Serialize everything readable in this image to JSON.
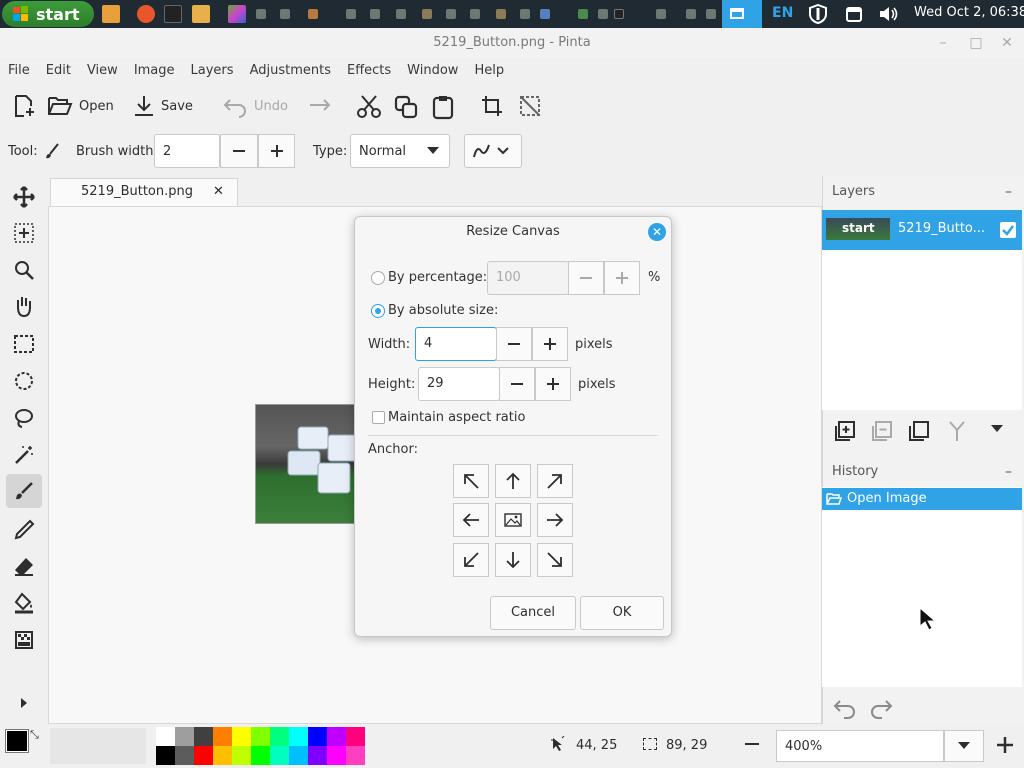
{
  "taskbar": {
    "start_label": "start",
    "language": "EN",
    "clock": "Wed Oct 2, 06:38"
  },
  "window": {
    "title": "5219_Button.png - Pinta"
  },
  "menu": [
    "File",
    "Edit",
    "View",
    "Image",
    "Layers",
    "Adjustments",
    "Effects",
    "Window",
    "Help"
  ],
  "toolbar": {
    "open_label": "Open",
    "save_label": "Save",
    "undo_label": "Undo"
  },
  "tool_options": {
    "tool_label": "Tool:",
    "brush_width_label": "Brush width:",
    "brush_width_value": "2",
    "type_label": "Type:",
    "type_value": "Normal"
  },
  "document": {
    "tab_name": "5219_Button.png"
  },
  "layers_panel": {
    "title": "Layers",
    "layer_name": "5219_Butto...",
    "thumb_label": "start"
  },
  "history_panel": {
    "title": "History",
    "items": [
      "Open Image"
    ]
  },
  "status": {
    "cursor_pos": "44, 25",
    "selection_size": "89, 29",
    "zoom": "400%"
  },
  "dialog": {
    "title": "Resize Canvas",
    "by_percentage_label": "By percentage:",
    "percentage_value": "100",
    "percent_unit": "%",
    "by_absolute_label": "By absolute size:",
    "width_label": "Width:",
    "width_value": "4",
    "height_label": "Height:",
    "height_value": "29",
    "pixels_unit": "pixels",
    "maintain_aspect_label": "Maintain aspect ratio",
    "anchor_label": "Anchor:",
    "cancel_label": "Cancel",
    "ok_label": "OK"
  },
  "palette_colors": [
    "#ffffff",
    "#000000",
    "#9e9e9e",
    "#5c5c5c",
    "#404040",
    "#ff0000",
    "#ff7f00",
    "#ffbf00",
    "#ffff00",
    "#bfff00",
    "#7fff00",
    "#00ff00",
    "#00ff7f",
    "#00ffbf",
    "#00ffff",
    "#00bfff",
    "#0000ff",
    "#7f00ff",
    "#bf00ff",
    "#ff00ff",
    "#ff007f",
    "#ff3fbf"
  ],
  "accent_color": "#2fa3e6"
}
